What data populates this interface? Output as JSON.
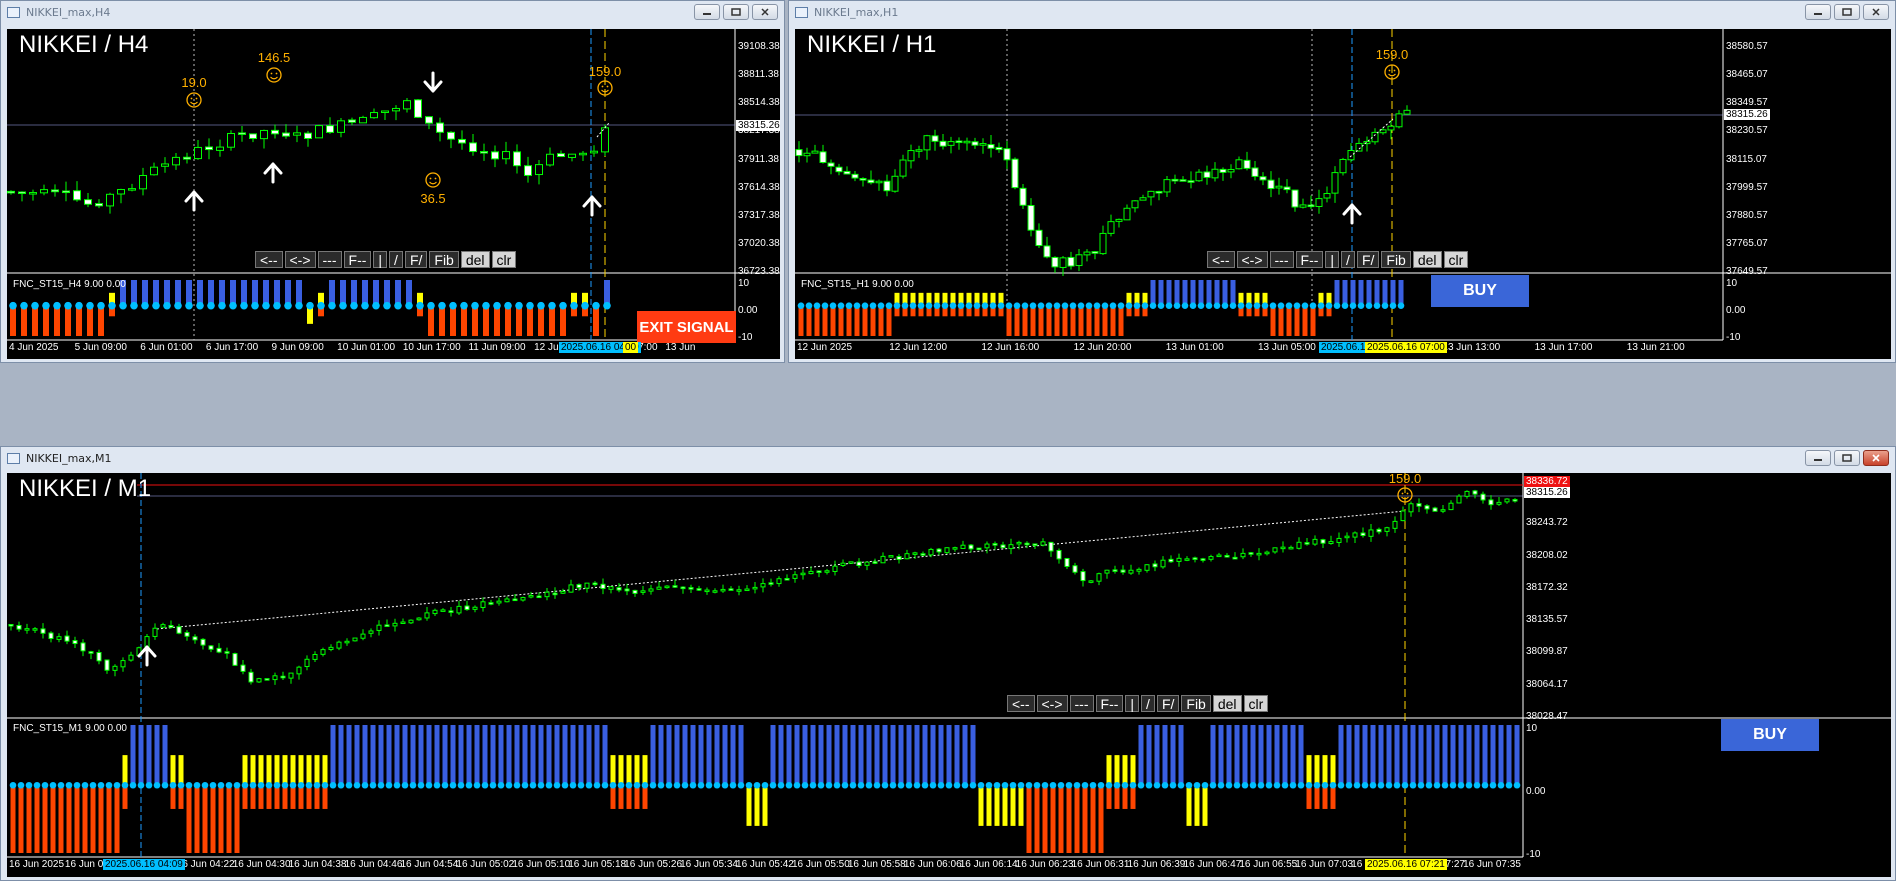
{
  "windows": {
    "h4": {
      "title": "NIKKEI_max,H4",
      "symbol": "NIKKEI / H4",
      "indicator": "FNC_ST15_H4 9.00 0.00",
      "signal": "EXIT SIGNAL",
      "y_ticks": [
        "39108.38",
        "38811.38",
        "38514.38",
        "38217.38",
        "37911.38",
        "37614.38",
        "37317.38",
        "37020.38",
        "36723.38"
      ],
      "price_box": "38315.26",
      "ind_ticks": [
        "10",
        "0.00",
        "-10"
      ],
      "x_ticks": [
        "4 Jun 2025",
        "5 Jun 09:00",
        "6 Jun 01:00",
        "6 Jun 17:00",
        "9 Jun 09:00",
        "10 Jun 01:00",
        "10 Jun 17:00",
        "11 Jun 09:00",
        "12 Jun 01:00",
        "12 Jun 17:00",
        "13 Jun"
      ],
      "x_highlight_cyan": "2025.06.16 04:09",
      "x_highlight_yellow": "00",
      "annotations": [
        "19.0",
        "146.5",
        "159.0",
        "36.5"
      ]
    },
    "h1": {
      "title": "NIKKEI_max,H1",
      "symbol": "NIKKEI / H1",
      "indicator": "FNC_ST15_H1 9.00 0.00",
      "signal": "BUY",
      "y_ticks": [
        "38580.57",
        "38465.07",
        "38349.57",
        "38230.57",
        "38115.07",
        "37999.57",
        "37880.57",
        "37765.07",
        "37649.57"
      ],
      "price_box": "38315.26",
      "ind_ticks": [
        "10",
        "0.00",
        "-10"
      ],
      "x_ticks": [
        "12 Jun 2025",
        "12 Jun 12:00",
        "12 Jun 16:00",
        "12 Jun 20:00",
        "13 Jun 01:00",
        "13 Jun 05:00",
        "13 Jun 09:00",
        "13 Jun 13:00",
        "13 Jun 17:00",
        "13 Jun 21:00"
      ],
      "x_highlight_cyan": "2025.06.16",
      "x_highlight_yellow": "2025.06.16 07:00",
      "annotations": [
        "159.0"
      ]
    },
    "m1": {
      "title": "NIKKEI_max,M1",
      "symbol": "NIKKEI / M1",
      "indicator": "FNC_ST15_M1 9.00 0.00",
      "signal": "BUY",
      "y_ticks": [
        "38279.42",
        "38243.72",
        "38208.02",
        "38172.32",
        "38135.57",
        "38099.87",
        "38064.17",
        "38028.47"
      ],
      "price_box": "38315.26",
      "price_box_red": "38336.72",
      "ind_ticks": [
        "10",
        "0.00",
        "-10"
      ],
      "x_ticks": [
        "16 Jun 2025",
        "16 Jun 03:5",
        "16 Jun 04:14",
        "16 Jun 04:22",
        "16 Jun 04:30",
        "16 Jun 04:38",
        "16 Jun 04:46",
        "16 Jun 04:54",
        "16 Jun 05:02",
        "16 Jun 05:10",
        "16 Jun 05:18",
        "16 Jun 05:26",
        "16 Jun 05:34",
        "16 Jun 05:42",
        "16 Jun 05:50",
        "16 Jun 05:58",
        "16 Jun 06:06",
        "16 Jun 06:14",
        "16 Jun 06:23",
        "16 Jun 06:31",
        "16 Jun 06:39",
        "16 Jun 06:47",
        "16 Jun 06:55",
        "16 Jun 07:03",
        "16 Jun 07",
        "16 Jun 07:27",
        "16 Jun 07:35"
      ],
      "x_highlight_cyan": "2025.06.16 04:09",
      "x_highlight_yellow": "2025.06.16 07:21",
      "annotations": [
        "159.0"
      ]
    }
  },
  "toolbar": [
    "<--",
    "<->",
    "---",
    "F--",
    "|",
    "/",
    "F/",
    "Fib",
    "del",
    "clr"
  ],
  "colors": {
    "up": "#00ff00",
    "bull_fill": "#ffffff",
    "blue_bar": "#3a5fe0",
    "red_bar": "#ff4500",
    "yellow": "#ffff00",
    "cyan": "#00bfff",
    "orange": "#ffb000",
    "signal_red": "#ff3b12",
    "signal_blue": "#3a66d8"
  }
}
